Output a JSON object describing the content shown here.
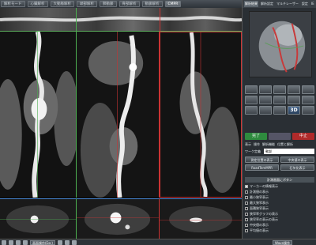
{
  "top_tabs": [
    {
      "label": "解析モード",
      "active": false
    },
    {
      "label": "心臓解析",
      "active": false
    },
    {
      "label": "大動脈解析",
      "active": false
    },
    {
      "label": "頭部解析",
      "active": false
    },
    {
      "label": "肺動脈",
      "active": false
    },
    {
      "label": "骨部解析",
      "active": false
    },
    {
      "label": "動脈解析",
      "active": false
    },
    {
      "label": "CMPR",
      "active": true
    }
  ],
  "panel": {
    "tabs": [
      {
        "label": "解析結果",
        "active": true
      },
      {
        "label": "解析設定",
        "active": false
      },
      {
        "label": "マルチレーザー",
        "active": false
      },
      {
        "label": "設定",
        "active": false
      },
      {
        "label": "IE",
        "active": false
      },
      {
        "label": "ml",
        "active": false
      }
    ],
    "tools": [
      "",
      "",
      "",
      "",
      "",
      "",
      "",
      "",
      "",
      "",
      "",
      "",
      "",
      "3D",
      ""
    ],
    "ok_buttons": [
      "完了",
      "",
      "中止"
    ],
    "menu": [
      "表示",
      "操作",
      "解析機能",
      "位置と解析"
    ],
    "field_label": "ワーク定義",
    "field_value": "軟部",
    "buttons": [
      "測定位置の表示",
      "中央値の表示",
      "RoadTemMPR",
      "石灰化表示",
      "計測画面にボタン"
    ],
    "options_header": "計測画面にボタン",
    "options": [
      {
        "label": "マーカーの情報表示",
        "checked": true
      },
      {
        "label": "計測値の表示",
        "checked": false
      },
      {
        "label": "最小狭窄表示",
        "checked": false
      },
      {
        "label": "最大狭窄表示",
        "checked": false
      },
      {
        "label": "面積狭窄表示",
        "checked": false
      },
      {
        "label": "狭窄率グラフの表示",
        "checked": false
      },
      {
        "label": "狭窄率の表示の表示",
        "checked": false
      },
      {
        "label": "中央値の表示",
        "checked": false
      },
      {
        "label": "平均値の表示",
        "checked": false
      }
    ]
  },
  "status_bar": {
    "left_button": "画面操作(Esc)",
    "right_button": "Wave操作"
  }
}
